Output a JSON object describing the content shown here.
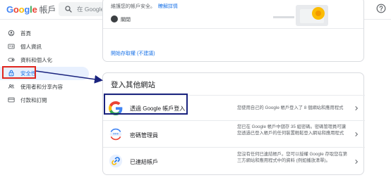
{
  "header": {
    "logo_letters": [
      "G",
      "o",
      "o",
      "g",
      "l",
      "e"
    ],
    "account_label": "帳戶",
    "search_placeholder": "在 Google 帳戶中搜尋"
  },
  "sidebar": {
    "items": [
      {
        "label": "首頁",
        "icon": "home-circle-icon"
      },
      {
        "label": "個人資訊",
        "icon": "id-card-icon"
      },
      {
        "label": "資料和個人化",
        "icon": "toggle-icon"
      },
      {
        "label": "安全性",
        "icon": "lock-icon",
        "active": true
      },
      {
        "label": "使用者和分享內容",
        "icon": "people-icon"
      },
      {
        "label": "付款和訂閱",
        "icon": "credit-card-icon"
      }
    ]
  },
  "top_card": {
    "text": "維護您的帳戶安全。",
    "link": "瞭解詳情",
    "close_label": "關閉",
    "cancel_link": "開始存取權 (不建議)"
  },
  "main_card": {
    "title": "登入其他網站",
    "rows": [
      {
        "label": "透過 Google 帳戶登入",
        "desc": "您使用自己的 Google 帳戶登入了 8 個網站和應用程式",
        "icon": "google-g-icon"
      },
      {
        "label": "密碼管理員",
        "desc": "您已在 Google 帳戶中儲存 35 組密碼。密碼管理員可讓您透過已登入帳戶的任何裝置輕鬆登入網站和應用程式",
        "icon": "password-key-icon"
      },
      {
        "label": "已連結帳戶",
        "desc": "您沒有任何已連結帳戶。您可以授權 Google 存取您在第三方網站和應用程式中的資料 (例如播放清單)。",
        "icon": "link-icon"
      }
    ]
  },
  "colors": {
    "accent": "#1a73e8",
    "highlight_red": "#e0261e",
    "highlight_navy": "#1a237e"
  }
}
